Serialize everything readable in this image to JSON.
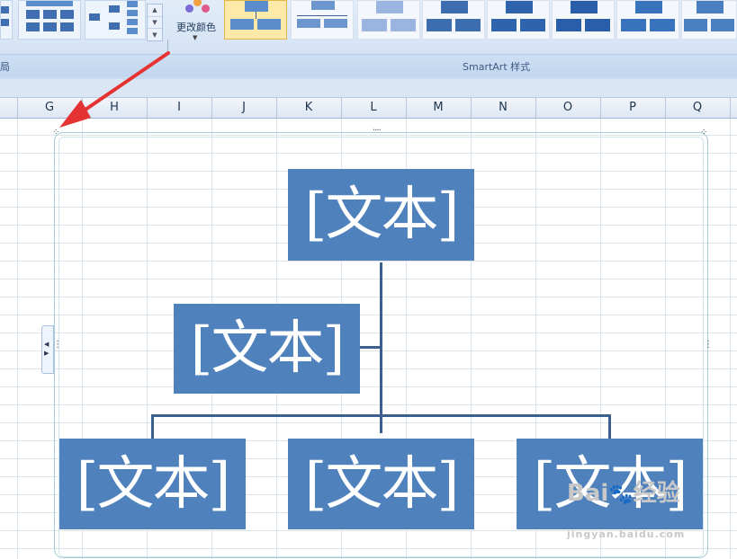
{
  "ribbon": {
    "change_colors_label": "更改颜色",
    "layouts_group_label": "局",
    "styles_group_label": "SmartArt 样式"
  },
  "columns": [
    "G",
    "H",
    "I",
    "J",
    "K",
    "L",
    "M",
    "N",
    "O",
    "P",
    "Q"
  ],
  "smartart": {
    "nodes": [
      {
        "role": "top",
        "text": "[文本]"
      },
      {
        "role": "assistant",
        "text": "[文本]"
      },
      {
        "role": "child-1",
        "text": "[文本]"
      },
      {
        "role": "child-2",
        "text": "[文本]"
      },
      {
        "role": "child-3",
        "text": "[文本]"
      }
    ],
    "fill_color": "#4f81bd",
    "line_color": "#3b5f8f"
  },
  "annotation": {
    "arrow_color": "#e53333"
  },
  "watermark": {
    "brand": "Bai",
    "brand_suffix": "经验",
    "url": "jingyan.baidu.com"
  }
}
